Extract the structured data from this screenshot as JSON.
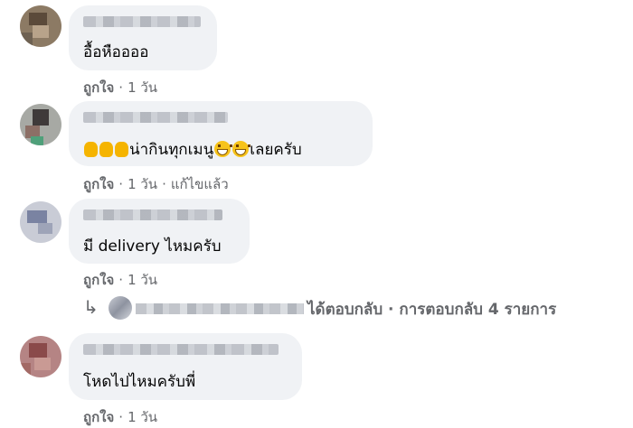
{
  "comments": [
    {
      "text": "อื้อหืออออ",
      "like_label": "ถูกใจ",
      "separator": "·",
      "time": "1 วัน"
    },
    {
      "text_prefix_icons": [
        "thumbs-up-icon",
        "thumbs-up-icon",
        "thumbs-up-icon"
      ],
      "text_main": "น่ากินทุกเมนู",
      "text_suffix": "เลยครับ",
      "like_label": "ถูกใจ",
      "separator": "·",
      "time": "1 วัน",
      "edited_label": "แก้ไขแล้ว"
    },
    {
      "text": "มี delivery ไหมครับ",
      "like_label": "ถูกใจ",
      "separator": "·",
      "time": "1 วัน"
    },
    {
      "text": "โหดไปไหมครับพี่",
      "like_label": "ถูกใจ",
      "separator": "·",
      "time": "1 วัน"
    }
  ],
  "reply_summary": {
    "text": "ได้ตอบกลับ · การตอบกลับ 4 รายการ",
    "icon": "reply-arrow-icon"
  },
  "colors": {
    "bubble": "#f0f2f5",
    "meta": "#65676b",
    "text": "#050505"
  }
}
